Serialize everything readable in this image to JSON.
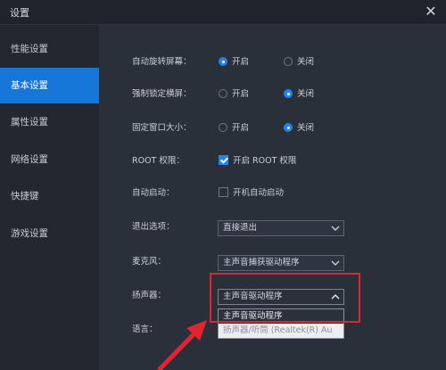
{
  "window": {
    "title": "设置"
  },
  "sidebar": {
    "items": [
      {
        "label": "性能设置",
        "active": false
      },
      {
        "label": "基本设置",
        "active": true
      },
      {
        "label": "属性设置",
        "active": false
      },
      {
        "label": "网络设置",
        "active": false
      },
      {
        "label": "快捷键",
        "active": false
      },
      {
        "label": "游戏设置",
        "active": false
      }
    ]
  },
  "settings": {
    "auto_rotate": {
      "label": "自动旋转屏幕：",
      "on": "开启",
      "off": "关闭",
      "value": "开启"
    },
    "force_landscape": {
      "label": "强制锁定横屏：",
      "on": "开启",
      "off": "关闭",
      "value": "关闭"
    },
    "fixed_window": {
      "label": "固定窗口大小：",
      "on": "开启",
      "off": "关闭",
      "value": "关闭"
    },
    "root": {
      "label": "ROOT 权限：",
      "option": "开启 ROOT 权限",
      "checked": true
    },
    "autostart": {
      "label": "自动启动：",
      "option": "开机自动启动",
      "checked": false
    },
    "exit_option": {
      "label": "退出选项：",
      "value": "直接退出"
    },
    "microphone": {
      "label": "麦克风：",
      "value": "主声音捕获驱动程序"
    },
    "speaker": {
      "label": "扬声器：",
      "value": "主声音驱动程序",
      "options": [
        "主声音驱动程序",
        "扬声器/听筒 (Realtek(R) Au"
      ]
    },
    "language": {
      "label": "语言："
    }
  },
  "colors": {
    "accent": "#1677d8",
    "highlight_box": "#e3242e"
  }
}
